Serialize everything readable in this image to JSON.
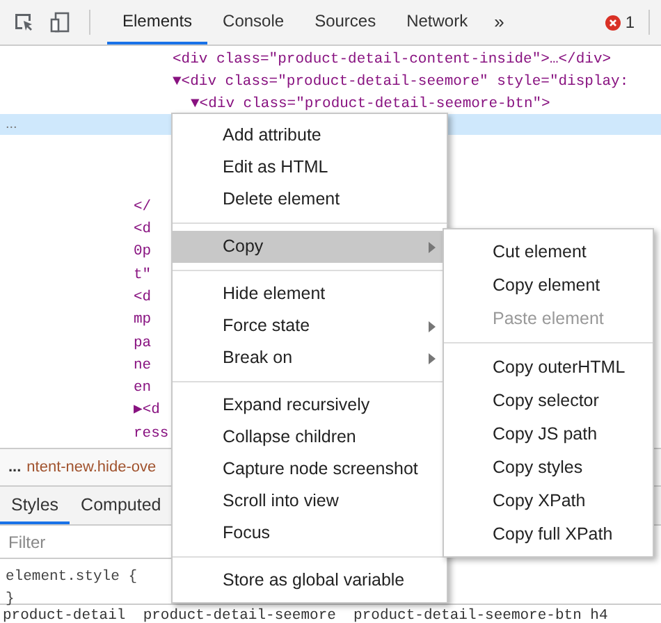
{
  "toolbar": {
    "tabs": [
      {
        "label": "Elements",
        "selected": true
      },
      {
        "label": "Console",
        "selected": false
      },
      {
        "label": "Sources",
        "selected": false
      },
      {
        "label": "Network",
        "selected": false
      }
    ],
    "overflow": "»",
    "error_count": "1"
  },
  "dom_lines": [
    "<div class=\"product-detail-content-inside\">…</div>",
    "▼<div class=\"product-detail-seemore\" style=\"display:",
    "▼<div class=\"product-detail-seemore-btn\">"
  ],
  "selected_row": {
    "gutter": "..."
  },
  "dom_fragments": [
    "</",
    "<d",
    "0p",
    "t\"",
    "<d",
    "mp",
    "pa",
    "ne",
    "en",
    "▶<d",
    "ress"
  ],
  "breadcrumb": {
    "more": "...",
    "text": "ntent-new.hide-ove"
  },
  "styles_tabs": [
    {
      "label": "Styles",
      "selected": true
    },
    {
      "label": "Computed",
      "selected": false
    }
  ],
  "filter": {
    "placeholder": "Filter"
  },
  "style_rule": [
    "element.style {",
    "}"
  ],
  "bottom_line": "product-detail  product-detail-seemore  product-detail-seemore-btn h4",
  "context_menu": [
    {
      "kind": "item",
      "label": "Add attribute",
      "selected": false
    },
    {
      "kind": "item",
      "label": "Edit as HTML",
      "selected": false
    },
    {
      "kind": "item",
      "label": "Delete element",
      "selected": false
    },
    {
      "kind": "separator"
    },
    {
      "kind": "submenu",
      "label": "Copy",
      "selected": true
    },
    {
      "kind": "separator"
    },
    {
      "kind": "item",
      "label": "Hide element",
      "selected": false
    },
    {
      "kind": "submenu",
      "label": "Force state",
      "selected": false
    },
    {
      "kind": "submenu",
      "label": "Break on",
      "selected": false
    },
    {
      "kind": "separator"
    },
    {
      "kind": "item",
      "label": "Expand recursively",
      "selected": false
    },
    {
      "kind": "item",
      "label": "Collapse children",
      "selected": false
    },
    {
      "kind": "item",
      "label": "Capture node screenshot",
      "selected": false
    },
    {
      "kind": "item",
      "label": "Scroll into view",
      "selected": false
    },
    {
      "kind": "item",
      "label": "Focus",
      "selected": false
    },
    {
      "kind": "separator"
    },
    {
      "kind": "item",
      "label": "Store as global variable",
      "selected": false
    }
  ],
  "copy_submenu": [
    {
      "kind": "item",
      "label": "Cut element",
      "disabled": false
    },
    {
      "kind": "item",
      "label": "Copy element",
      "disabled": false
    },
    {
      "kind": "item",
      "label": "Paste element",
      "disabled": true
    },
    {
      "kind": "separator"
    },
    {
      "kind": "item",
      "label": "Copy outerHTML",
      "disabled": false
    },
    {
      "kind": "item",
      "label": "Copy selector",
      "disabled": false
    },
    {
      "kind": "item",
      "label": "Copy JS path",
      "disabled": false
    },
    {
      "kind": "item",
      "label": "Copy styles",
      "disabled": false
    },
    {
      "kind": "item",
      "label": "Copy XPath",
      "disabled": false
    },
    {
      "kind": "item",
      "label": "Copy full XPath",
      "disabled": false
    }
  ]
}
